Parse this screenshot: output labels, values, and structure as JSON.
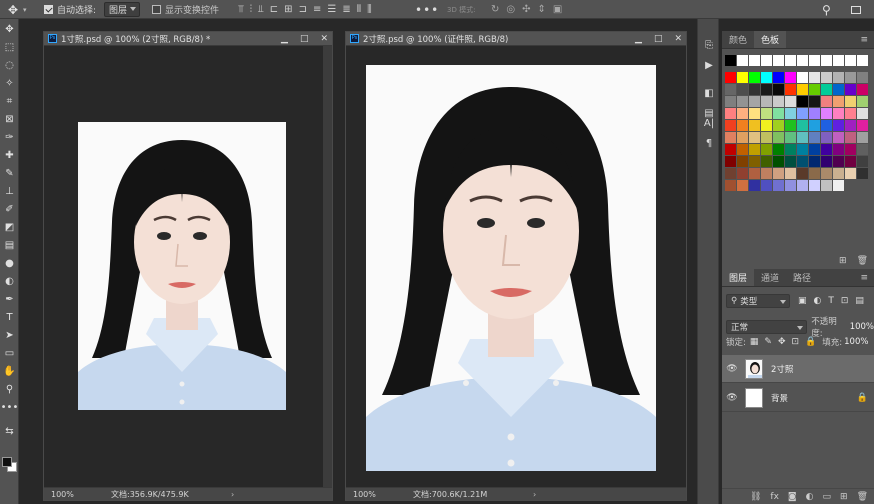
{
  "options_bar": {
    "auto_select_label": "自动选择:",
    "auto_select_value": "图层",
    "show_transform_label": "显示变换控件",
    "three_d_label": "3D 模式:",
    "more": "•••"
  },
  "documents": [
    {
      "title": "1寸照.psd @ 100% (2寸照, RGB/8) *",
      "zoom": "100%",
      "doc_size": "文档:356.9K/475.9K",
      "ctrls": [
        "▁",
        "□",
        "✕"
      ]
    },
    {
      "title": "2寸照.psd @ 100% (证件照, RGB/8)",
      "zoom": "100%",
      "doc_size": "文档:700.6K/1.21M",
      "ctrls": [
        "▁",
        "□",
        "✕"
      ]
    }
  ],
  "color_panel": {
    "tabs": [
      "颜色",
      "色板"
    ],
    "active_tab": "色板",
    "menu": "≡",
    "swatch_rows": [
      [
        "#000000",
        "#ffffff",
        "#ffffff",
        "#ffffff",
        "#ffffff",
        "#ffffff",
        "#ffffff",
        "#ffffff",
        "#ffffff",
        "#ffffff",
        "#ffffff",
        "#ffffff"
      ],
      [
        "#ff0000",
        "#ffff00",
        "#00ff00",
        "#00ffff",
        "#0000ff",
        "#ff00ff",
        "#ffffff",
        "#e6e6e6",
        "#cccccc",
        "#b3b3b3",
        "#999999",
        "#808080"
      ],
      [
        "#666666",
        "#4d4d4d",
        "#333333",
        "#1a1a1a",
        "#0a0a0a",
        "#ff3300",
        "#ffcc00",
        "#66cc00",
        "#00cc99",
        "#0066cc",
        "#6600cc",
        "#cc0066"
      ],
      [
        "#7f7f7f",
        "#939393",
        "#a5a5a5",
        "#b7b7b7",
        "#cacaca",
        "#dcdcdc",
        "#000000",
        "#161616",
        "#f08080",
        "#f0a070",
        "#f0d070",
        "#a0d070"
      ],
      [
        "#ff8080",
        "#ffb080",
        "#ffe080",
        "#c0e080",
        "#80e0a0",
        "#80d0e0",
        "#80a0ff",
        "#a080ff",
        "#e080ff",
        "#ff80c0",
        "#ff8090",
        "#e0e0e0"
      ],
      [
        "#f04020",
        "#f08020",
        "#f0c020",
        "#f0f020",
        "#a0d020",
        "#20c020",
        "#20c0a0",
        "#20a0e0",
        "#2060e0",
        "#6020e0",
        "#a020c0",
        "#e020a0"
      ],
      [
        "#e08060",
        "#e0a060",
        "#e0c080",
        "#c0c060",
        "#80c060",
        "#60c080",
        "#60c0c0",
        "#6080c0",
        "#8060c0",
        "#c060c0",
        "#c06080",
        "#a0a0a0"
      ],
      [
        "#c00000",
        "#c06000",
        "#c0a000",
        "#80a000",
        "#008000",
        "#008060",
        "#0080a0",
        "#0040a0",
        "#4000a0",
        "#800080",
        "#a00060",
        "#606060"
      ],
      [
        "#800000",
        "#804000",
        "#806000",
        "#406000",
        "#005000",
        "#005040",
        "#005070",
        "#002870",
        "#300070",
        "#500050",
        "#700040",
        "#404040"
      ],
      [
        "#704030",
        "#904030",
        "#b06040",
        "#c08060",
        "#d0a080",
        "#e0c0a0",
        "#5a3a2a",
        "#8a6a4a",
        "#aa8a6a",
        "#cab090",
        "#ead0b0",
        "#303030"
      ],
      [
        "#a05030",
        "#d07040",
        "#3030a0",
        "#5050c0",
        "#7070d0",
        "#9090e0",
        "#b0b0f0",
        "#d0d0ff",
        "#c0c0c0",
        "#f0f0f0"
      ]
    ]
  },
  "layers_panel": {
    "tabs": [
      "图层",
      "通道",
      "路径"
    ],
    "active_tab": "图层",
    "menu": "≡",
    "filter_label": "类型",
    "blend_mode": "正常",
    "opacity_label": "不透明度:",
    "opacity_value": "100%",
    "lock_label": "锁定:",
    "fill_label": "填充:",
    "fill_value": "100%",
    "layers": [
      {
        "name": "2寸照",
        "selected": true
      },
      {
        "name": "背景",
        "selected": false
      }
    ]
  }
}
